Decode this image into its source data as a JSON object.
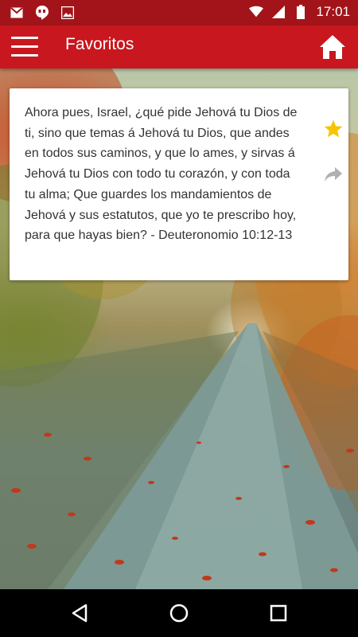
{
  "status_bar": {
    "time": "17:01",
    "left_icons": [
      "gmail-icon",
      "hangouts-icon",
      "image-icon"
    ],
    "right_icons": [
      "wifi-icon",
      "signal-icon",
      "battery-icon"
    ]
  },
  "app_bar": {
    "title": "Favoritos",
    "menu_icon": "menu-icon",
    "home_icon": "home-icon",
    "color": "#c8171e"
  },
  "favorites": [
    {
      "text": "Ahora pues, Israel, ¿qué pide Jehová tu Dios de ti, sino que temas á Jehová tu Dios, que andes en todos sus caminos, y que lo ames, y sirvas á Jehová tu Dios con todo tu corazón, y con toda tu alma; Que guardes los mandamientos de Jehová y sus estatutos, que yo te prescribo hoy, para que hayas bien? - Deuteronomio 10:12-13",
      "starred": true,
      "star_color": "#f6c400"
    }
  ],
  "nav_bar": {
    "buttons": [
      "back-icon",
      "home-circle-icon",
      "recents-icon"
    ]
  }
}
